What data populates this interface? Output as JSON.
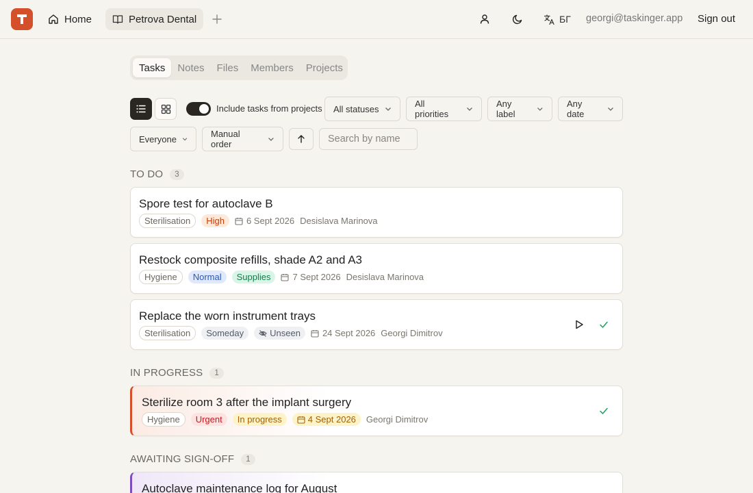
{
  "topbar": {
    "logo_letter": "T",
    "home_label": "Home",
    "workspace_label": "Petrova Dental",
    "lang_label": "БГ",
    "email": "georgi@taskinger.app",
    "signout_label": "Sign out"
  },
  "tabs": [
    {
      "label": "Tasks",
      "active": true
    },
    {
      "label": "Notes"
    },
    {
      "label": "Files"
    },
    {
      "label": "Members"
    },
    {
      "label": "Projects"
    }
  ],
  "filters": {
    "include_projects_label": "Include tasks from projects",
    "include_projects_on": true,
    "status": "All statuses",
    "priority": "All priorities",
    "label": "Any label",
    "date": "Any date",
    "assignee": "Everyone",
    "order": "Manual order",
    "search_placeholder": "Search by name"
  },
  "sections": {
    "todo": {
      "label": "TO DO",
      "count": "3",
      "tasks": [
        {
          "title": "Spore test for autoclave B",
          "tag": "Sterilisation",
          "priority": "High",
          "date": "6 Sept 2026",
          "assignee": "Desislava Marinova"
        },
        {
          "title": "Restock composite refills, shade A2 and A3",
          "tag": "Hygiene",
          "priority": "Normal",
          "label": "Supplies",
          "date": "7 Sept 2026",
          "assignee": "Desislava Marinova"
        },
        {
          "title": "Replace the worn instrument trays",
          "tag": "Sterilisation",
          "priority": "Someday",
          "label": "Unseen",
          "date": "24 Sept 2026",
          "assignee": "Georgi Dimitrov"
        }
      ]
    },
    "in_progress": {
      "label": "IN PROGRESS",
      "count": "1",
      "tasks": [
        {
          "title": "Sterilize room 3 after the implant surgery",
          "tag": "Hygiene",
          "priority": "Urgent",
          "status": "In progress",
          "date": "4 Sept 2026",
          "assignee": "Georgi Dimitrov"
        }
      ]
    },
    "awaiting": {
      "label": "AWAITING SIGN-OFF",
      "count": "1",
      "tasks": [
        {
          "title": "Autoclave maintenance log for August"
        }
      ]
    }
  },
  "colors": {
    "brand": "#d4502b",
    "in_progress_accent": "#d4502b",
    "awaiting_accent": "#7c4dbd",
    "done_check": "#1e9e5a"
  }
}
